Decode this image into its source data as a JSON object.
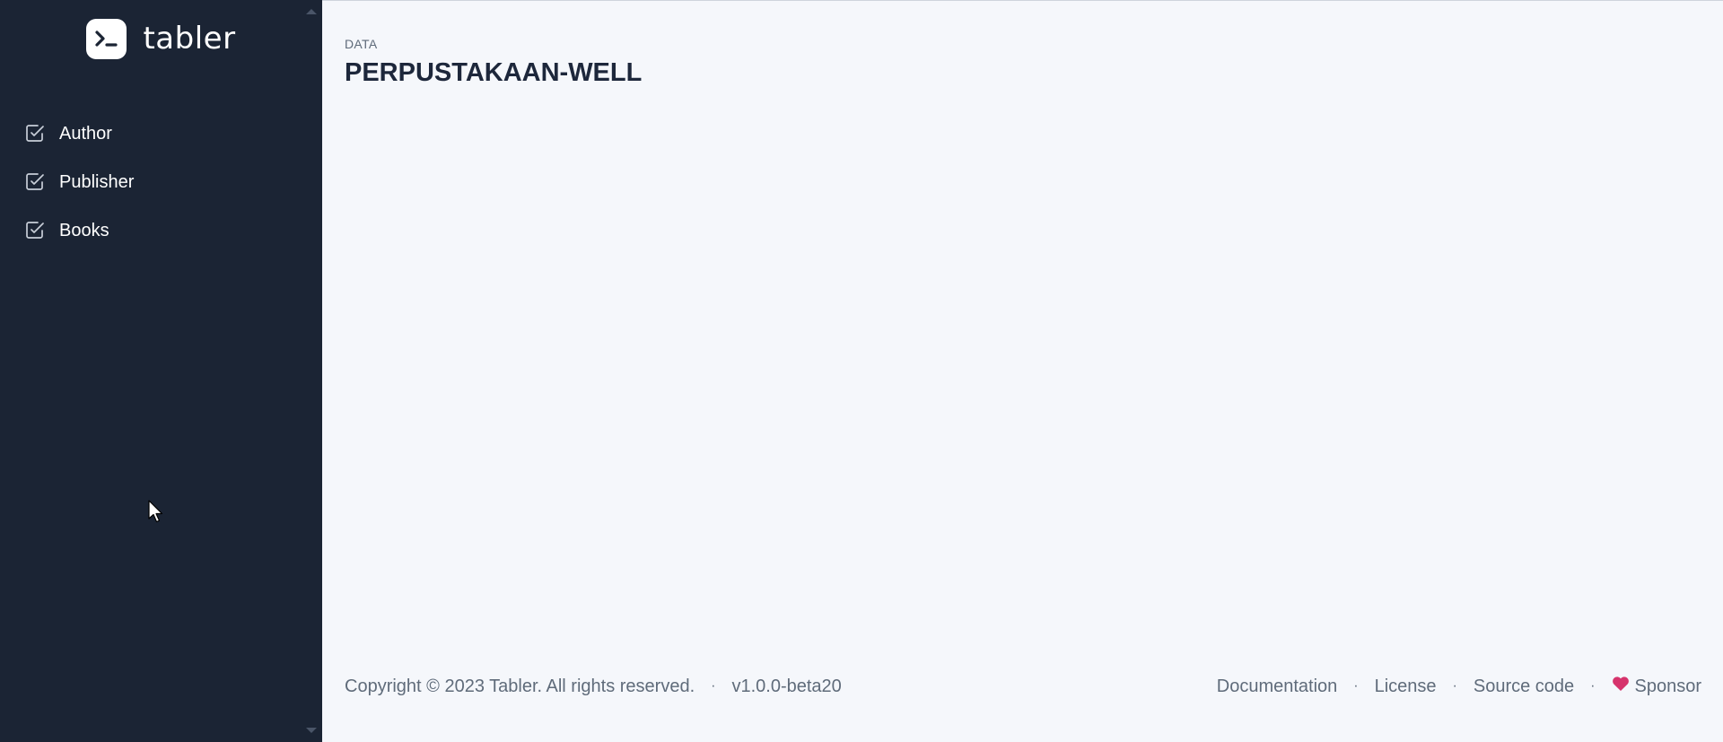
{
  "brand": {
    "name": "tabler",
    "logo_icon": "terminal-icon"
  },
  "sidebar": {
    "items": [
      {
        "label": "Author",
        "icon": "checkbox-icon"
      },
      {
        "label": "Publisher",
        "icon": "checkbox-icon"
      },
      {
        "label": "Books",
        "icon": "checkbox-icon"
      }
    ]
  },
  "header": {
    "pretitle": "DATA",
    "title": "PERPUSTAKAAN-WELL"
  },
  "footer": {
    "copyright": "Copyright © 2023 Tabler. All rights reserved.",
    "version": "v1.0.0-beta20",
    "separator": "·",
    "links": {
      "documentation": "Documentation",
      "license": "License",
      "source_code": "Source code",
      "sponsor": "Sponsor"
    }
  },
  "colors": {
    "sidebar_bg": "#1b2434",
    "page_bg": "#f5f7fb",
    "heart": "#d6336c"
  }
}
